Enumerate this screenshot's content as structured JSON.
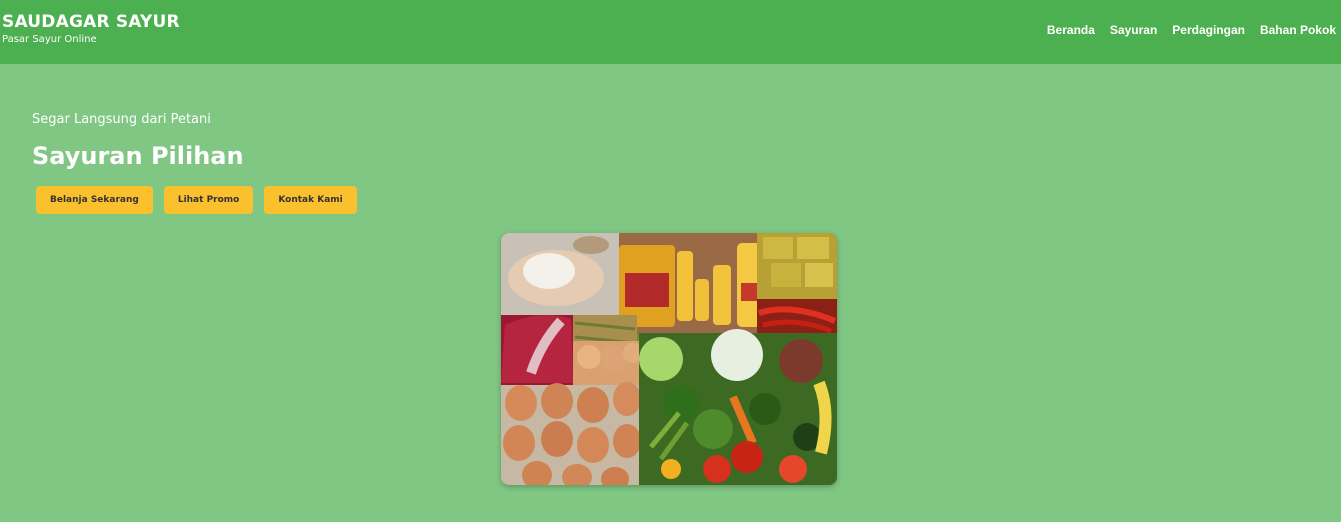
{
  "brand": {
    "title": "SAUDAGAR SAYUR",
    "subtitle": "Pasar Sayur Online"
  },
  "nav": {
    "items": [
      {
        "label": "Beranda"
      },
      {
        "label": "Sayuran"
      },
      {
        "label": "Perdagingan"
      },
      {
        "label": "Bahan Pokok"
      }
    ]
  },
  "hero": {
    "tagline": "Segar Langsung dari Petani",
    "title": "Sayuran Pilihan",
    "buttons": [
      {
        "label": "Belanja Sekarang"
      },
      {
        "label": "Lihat Promo"
      },
      {
        "label": "Kontak Kami"
      }
    ],
    "image": {
      "subject": "collage of groceries: rice, cooking oil bottles, tofu, red chilies, sugar, eggs, fresh vegetables"
    }
  },
  "colors": {
    "navbar": "#4caf50",
    "background": "#80c784",
    "button": "#fbc02d",
    "text": "#ffffff"
  }
}
